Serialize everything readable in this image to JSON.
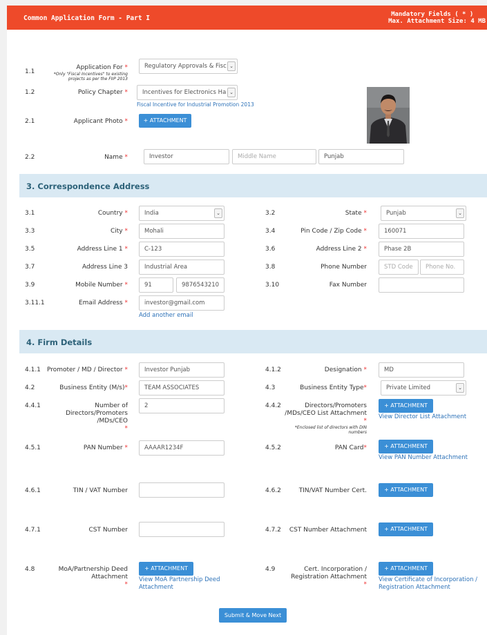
{
  "header": {
    "title": "Common Application Form - Part I",
    "mandatory": "Mandatory Fields ( * )",
    "max_attachment": "Max. Attachment Size: 4 MB"
  },
  "top": {
    "r11": {
      "num": "1.1",
      "label": "Application For",
      "note1": "*Only \"Fiscal Incentives\" to existing",
      "note2": "projects as per the FIIP 2013",
      "value": "Regulatory Approvals & Fisc"
    },
    "r12": {
      "num": "1.2",
      "label": "Policy Chapter",
      "value": "Incentives for Electronics Ha",
      "link": "Fiscal Incentive for Industrial Promotion 2013"
    },
    "r21": {
      "num": "2.1",
      "label": "Applicant Photo",
      "button": "+ ATTACHMENT"
    },
    "r22": {
      "num": "2.2",
      "label": "Name",
      "first": "Investor",
      "middle_ph": "Middle Name",
      "last": "Punjab"
    }
  },
  "corr": {
    "title": "3. Correspondence Address",
    "country": {
      "num": "3.1",
      "label": "Country",
      "value": "India"
    },
    "state": {
      "num": "3.2",
      "label": "State",
      "value": "Punjab"
    },
    "city": {
      "num": "3.3",
      "label": "City",
      "value": "Mohali"
    },
    "pin": {
      "num": "3.4",
      "label": "Pin Code / Zip Code",
      "value": "160071"
    },
    "addr1": {
      "num": "3.5",
      "label": "Address Line 1",
      "value": "C-123"
    },
    "addr2": {
      "num": "3.6",
      "label": "Address Line 2",
      "value": "Phase 2B"
    },
    "addr3": {
      "num": "3.7",
      "label": "Address Line 3",
      "value": "Industrial Area"
    },
    "phone": {
      "num": "3.8",
      "label": "Phone Number",
      "std_ph": "STD Code",
      "no_ph": "Phone No."
    },
    "mobile": {
      "num": "3.9",
      "label": "Mobile Number",
      "code": "91",
      "value": "9876543210"
    },
    "fax": {
      "num": "3.10",
      "label": "Fax Number"
    },
    "email": {
      "num": "3.11.1",
      "label": "Email Address",
      "value": "investor@gmail.com",
      "link": "Add another email"
    }
  },
  "firm": {
    "title": "4. Firm Details",
    "promoter": {
      "num": "4.1.1",
      "label": "Promoter / MD / Director",
      "value": "Investor Punjab"
    },
    "designation": {
      "num": "4.1.2",
      "label": "Designation",
      "value": "MD"
    },
    "entity": {
      "num": "4.2",
      "label": "Business Entity (M/s)",
      "value": "TEAM ASSOCIATES"
    },
    "entity_type": {
      "num": "4.3",
      "label": "Business Entity Type",
      "value": "Private Limited"
    },
    "directors": {
      "num": "4.4.1",
      "label1": "Number of",
      "label2": "Directors/Promoters",
      "label3": "/MDs/CEO",
      "value": "2"
    },
    "dir_list": {
      "num": "4.4.2",
      "label1": "Directors/Promoters",
      "label2": "/MDs/CEO List Attachment",
      "note1": "*Enclosed list of directors with DIN",
      "note2": "numbers",
      "button": "+ ATTACHMENT",
      "link": "View Director List Attachment"
    },
    "pan": {
      "num": "4.5.1",
      "label": "PAN Number",
      "value": "AAAAR1234F"
    },
    "pan_card": {
      "num": "4.5.2",
      "label": "PAN Card",
      "button": "+ ATTACHMENT",
      "link": "View PAN Number Attachment"
    },
    "tin": {
      "num": "4.6.1",
      "label": "TIN / VAT Number"
    },
    "tin_cert": {
      "num": "4.6.2",
      "label": "TIN/VAT Number Cert.",
      "button": "+ ATTACHMENT"
    },
    "cst": {
      "num": "4.7.1",
      "label": "CST Number"
    },
    "cst_att": {
      "num": "4.7.2",
      "label": "CST Number Attachment",
      "button": "+ ATTACHMENT"
    },
    "moa": {
      "num": "4.8",
      "label1": "MoA/Partnership Deed",
      "label2": "Attachment",
      "button": "+ ATTACHMENT",
      "link1": "View MoA Partnership Deed",
      "link2": "Attachment"
    },
    "cert": {
      "num": "4.9",
      "label1": "Cert. Incorporation /",
      "label2": "Registration Attachment",
      "button": "+ ATTACHMENT",
      "link1": "View Certificate of Incorporation /",
      "link2": "Registration Attachment"
    }
  },
  "submit": "Submit & Move Next",
  "required_mark": "*",
  "icons": {
    "dropdown": "chevron-down-icon",
    "photo": "applicant-photo"
  }
}
